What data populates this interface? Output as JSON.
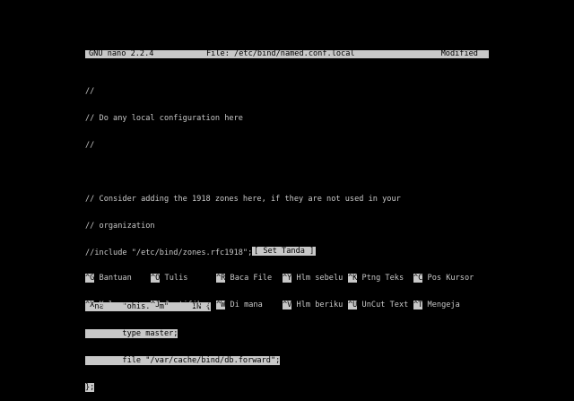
{
  "titlebar": {
    "app": "GNU nano 2.2.4",
    "file": "File: /etc/bind/named.conf.local",
    "status": "Modified"
  },
  "editor": {
    "lines": [
      "//",
      "// Do any local configuration here",
      "//",
      "",
      "// Consider adding the 1918 zones here, if they are not used in your",
      "// organization",
      "//include \"/etc/bind/zones.rfc1918\";",
      "",
      "zone    \"ohis.com\"     IN {",
      "        type master;",
      "        file \"/var/cache/bind/db.forward\";",
      "};"
    ]
  },
  "status_message": "[ Set Tanda ]",
  "shortcuts": {
    "row1": [
      {
        "key": "^G",
        "label": "Bantuan"
      },
      {
        "key": "^O",
        "label": "Tulis"
      },
      {
        "key": "^R",
        "label": "Baca File"
      },
      {
        "key": "^Y",
        "label": "Hlm sebelu"
      },
      {
        "key": "^K",
        "label": "Ptng Teks"
      },
      {
        "key": "^C",
        "label": "Pos Kursor"
      }
    ],
    "row2": [
      {
        "key": "^X",
        "label": "Keluar"
      },
      {
        "key": "^J",
        "label": "Justifikas"
      },
      {
        "key": "^W",
        "label": "Di mana"
      },
      {
        "key": "^V",
        "label": "Hlm beriku"
      },
      {
        "key": "^U",
        "label": "UnCut Text"
      },
      {
        "key": "^T",
        "label": "Mengeja"
      }
    ]
  }
}
